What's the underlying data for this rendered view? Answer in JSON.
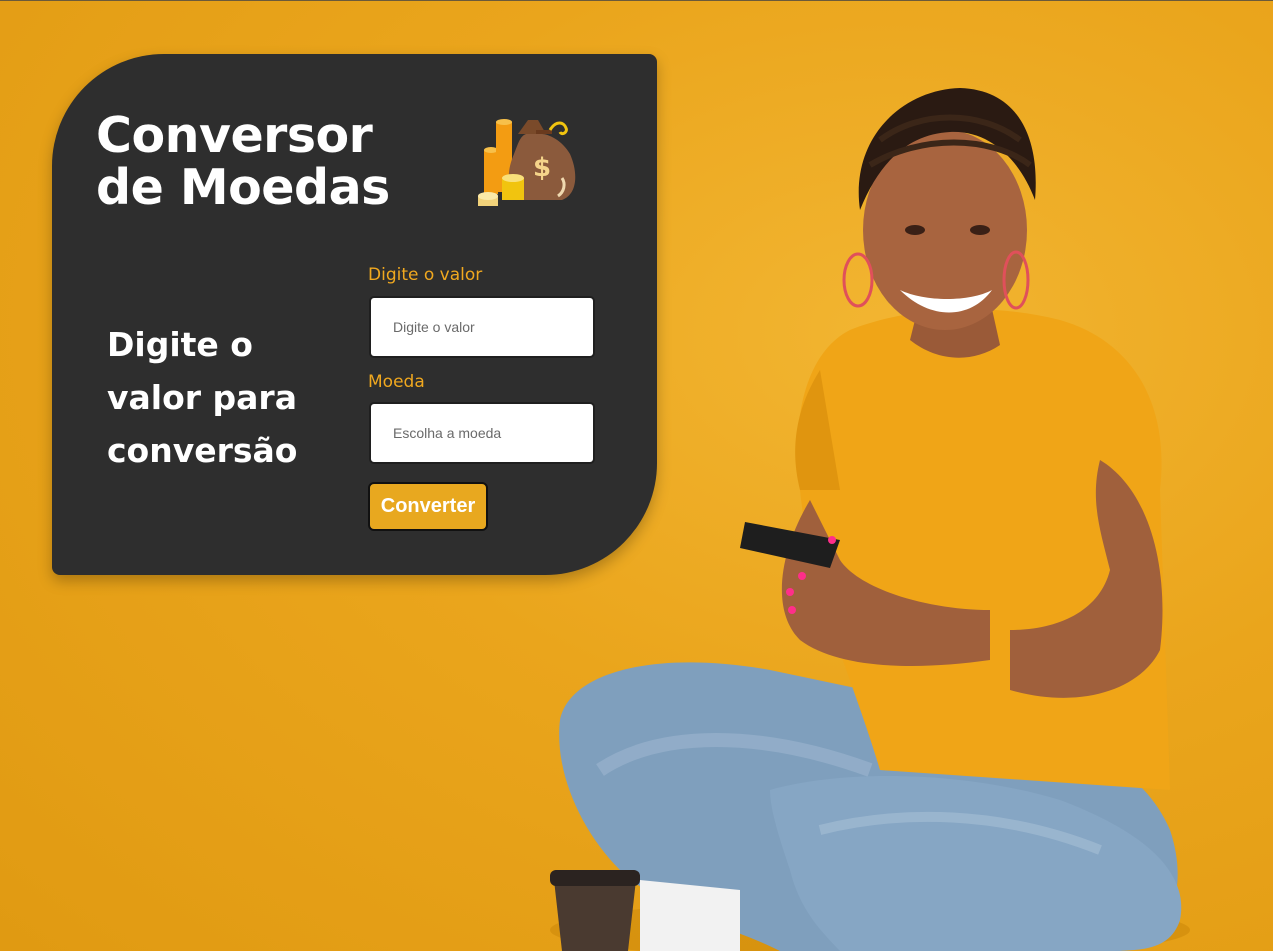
{
  "page": {
    "title_line1": "Conversor",
    "title_line2": "de Moedas",
    "subtitle_line1": "Digite o",
    "subtitle_line2": "valor para",
    "subtitle_line3": "conversão"
  },
  "form": {
    "value_label": "Digite o valor",
    "value_placeholder": "Digite o valor",
    "currency_label": "Moeda",
    "currency_placeholder": "Escolha a moeda",
    "convert_label": "Converter"
  },
  "icons": {
    "money": "money-bag-coins-icon"
  },
  "colors": {
    "background": "#eaa51c",
    "card": "#2e2e2e",
    "accent": "#f0a81f",
    "button": "#e8a81f"
  }
}
